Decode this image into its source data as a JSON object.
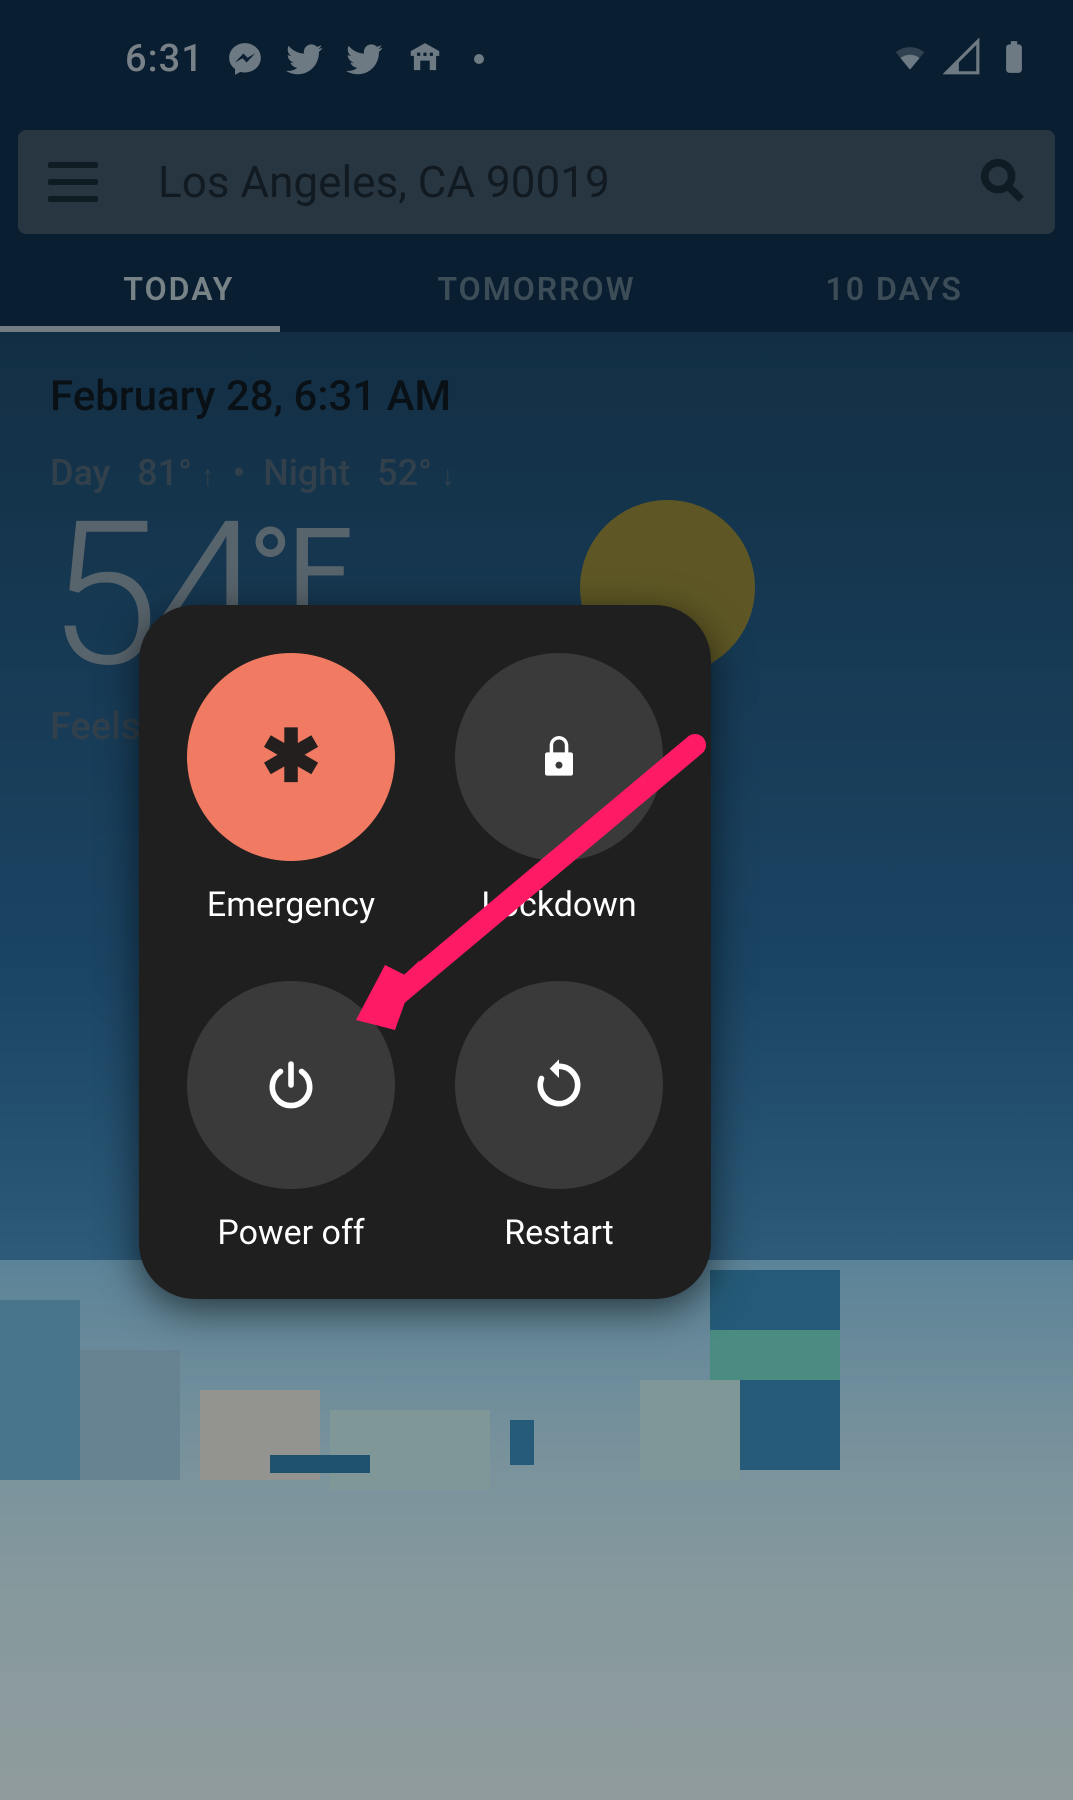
{
  "status_bar": {
    "time": "6:31",
    "icons": [
      "messenger-icon",
      "twitter-icon",
      "twitter-icon",
      "printer-icon",
      "dot-icon"
    ],
    "right_icons": [
      "wifi-icon",
      "cell-signal-icon",
      "battery-icon"
    ]
  },
  "search": {
    "location_text": "Los Angeles, CA 90019"
  },
  "tabs": [
    {
      "label": "TODAY",
      "active": true
    },
    {
      "label": "TOMORROW",
      "active": false
    },
    {
      "label": "10 DAYS",
      "active": false
    }
  ],
  "weather": {
    "date_line": "February 28, 6:31 AM",
    "day_label": "Day",
    "day_temp": "81°",
    "night_label": "Night",
    "night_temp": "52°",
    "big_temp": "54",
    "unit": "°F",
    "feels_label": "Feels l"
  },
  "power_menu": {
    "items": [
      {
        "key": "emergency",
        "label": "Emergency"
      },
      {
        "key": "lockdown",
        "label": "Lockdown"
      },
      {
        "key": "poweroff",
        "label": "Power off"
      },
      {
        "key": "restart",
        "label": "Restart"
      }
    ]
  },
  "colors": {
    "emergency_button": "#f17a63",
    "menu_bg": "#1f1f1f",
    "arrow": "#ff1a66"
  }
}
